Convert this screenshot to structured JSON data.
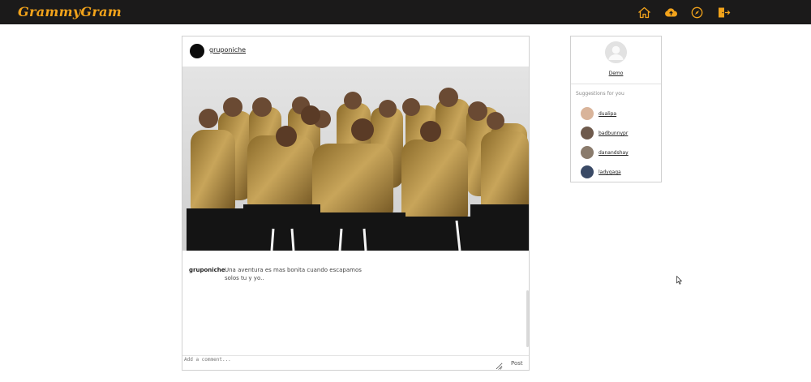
{
  "app": {
    "brand": "GrammyGram"
  },
  "nav": {
    "icons": [
      "home-icon",
      "upload-icon",
      "explore-icon",
      "logout-icon"
    ],
    "accent_color": "#f2a31b",
    "bar_color": "#1b1a1a"
  },
  "post": {
    "username": "gruponiche",
    "image_alt": "Group photo of the band in gold shirts",
    "caption_user": "gruponiche",
    "caption_text": "Una aventura es mas bonita cuando escapamos solos tu y yo..",
    "comment_placeholder": "Add a comment...",
    "post_label": "Post"
  },
  "sidebar": {
    "profile_name": "Demo",
    "suggestions_title": "Suggestions for you",
    "suggestions": [
      {
        "username": "dualipa",
        "color": "#d9b49a"
      },
      {
        "username": "badbunnypr",
        "color": "#6e5a4c"
      },
      {
        "username": "danandshay",
        "color": "#8a7b6c"
      },
      {
        "username": "ladygaga",
        "color": "#3a4a66"
      }
    ]
  }
}
